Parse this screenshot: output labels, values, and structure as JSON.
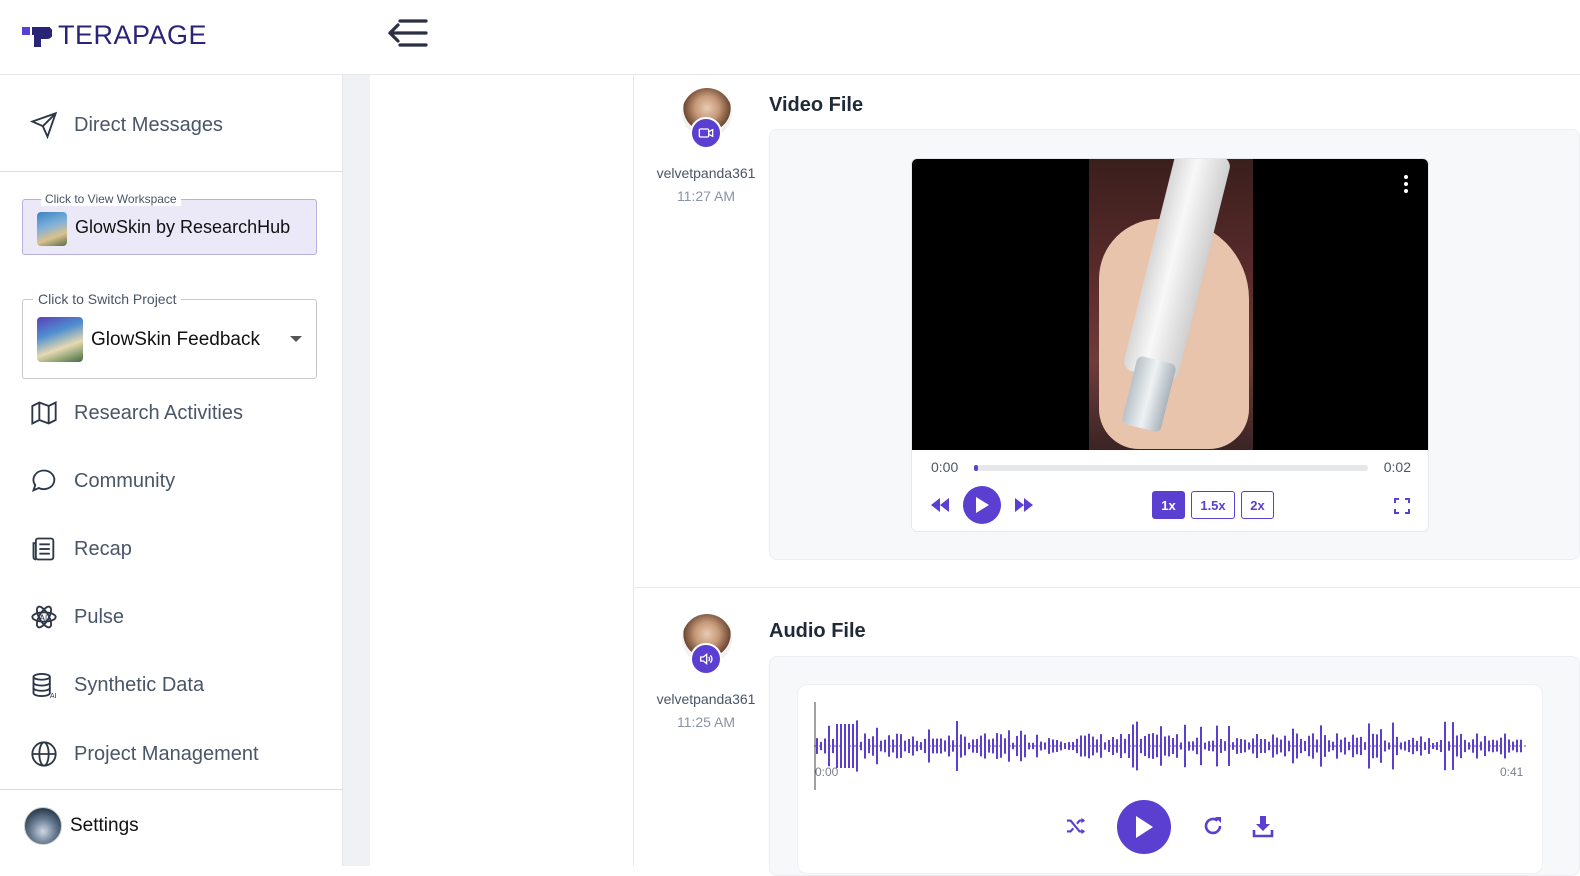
{
  "brand": {
    "logo_text": "TERAPAGE",
    "accent": "#5b3fd0"
  },
  "sidebar": {
    "direct_messages": "Direct Messages",
    "workspace": {
      "legend": "Click to View Workspace",
      "name": "GlowSkin by ResearchHub"
    },
    "project": {
      "legend": "Click to Switch Project",
      "name": "GlowSkin Feedback"
    },
    "items": [
      {
        "label": "Research Activities",
        "icon": "map-icon"
      },
      {
        "label": "Community",
        "icon": "chat-bubble-icon"
      },
      {
        "label": "Recap",
        "icon": "newspaper-icon"
      },
      {
        "label": "Pulse",
        "icon": "ai-atom-icon"
      },
      {
        "label": "Synthetic Data",
        "icon": "database-ai-icon"
      },
      {
        "label": "Project Management",
        "icon": "globe-icon"
      }
    ],
    "settings": "Settings"
  },
  "posts": [
    {
      "title": "Video File",
      "user": "velvetpanda361",
      "time": "11:27 AM",
      "badge_icon": "video-camera-icon",
      "player": {
        "current": "0:00",
        "duration": "0:02",
        "progress": 0.01,
        "speeds": [
          "1x",
          "1.5x",
          "2x"
        ],
        "active_speed": "1x"
      }
    },
    {
      "title": "Audio File",
      "user": "velvetpanda361",
      "time": "11:25 AM",
      "badge_icon": "speaker-icon",
      "audio": {
        "current": "0:00",
        "duration": "0:41"
      }
    }
  ]
}
